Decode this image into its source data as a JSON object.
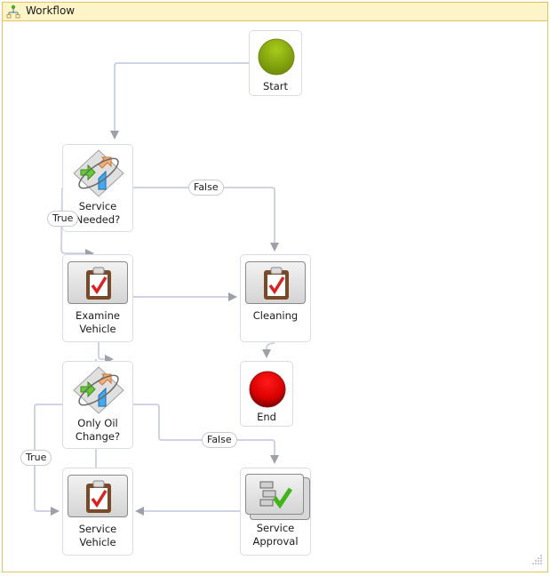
{
  "window": {
    "title": "Workflow",
    "icon": "workflow-icon"
  },
  "nodes": {
    "start": {
      "label": "Start",
      "type": "start",
      "color": "#8fb30e"
    },
    "service_needed": {
      "label_line1": "Service",
      "label_line2": "Needed?",
      "type": "decision"
    },
    "examine_vehicle": {
      "label_line1": "Examine",
      "label_line2": "Vehicle",
      "type": "activity"
    },
    "cleaning": {
      "label": "Cleaning",
      "type": "activity"
    },
    "end": {
      "label": "End",
      "type": "end",
      "color": "#e00000"
    },
    "only_oil_change": {
      "label_line1": "Only Oil",
      "label_line2": "Change?",
      "type": "decision"
    },
    "service_vehicle": {
      "label_line1": "Service",
      "label_line2": "Vehicle",
      "type": "activity"
    },
    "service_approval": {
      "label_line1": "Service",
      "label_line2": "Approval",
      "type": "approval"
    }
  },
  "edges": {
    "service_needed_true": "True",
    "service_needed_false": "False",
    "only_oil_true": "True",
    "only_oil_false": "False"
  },
  "colors": {
    "connector": "#d0d3e3",
    "arrow": "#a0a0a8",
    "frame": "#e5c365",
    "titlebar_bg": "#fdf4c7"
  }
}
